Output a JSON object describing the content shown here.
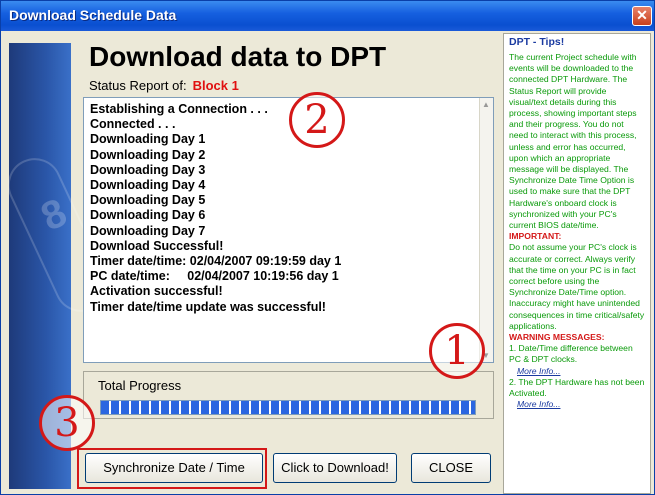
{
  "window": {
    "title": "Download Schedule Data",
    "close_glyph": "✕"
  },
  "header": {
    "heading": "Download data to DPT",
    "status_label": "Status Report of:",
    "status_value": "Block 1"
  },
  "log": {
    "lines": [
      "Establishing a Connection . . .",
      "Connected . . .",
      "Downloading Day 1",
      "Downloading Day 2",
      "Downloading Day 3",
      "Downloading Day 4",
      "Downloading Day 5",
      "Downloading Day 6",
      "Downloading Day 7",
      "Download Successful!",
      "Timer date/time: 02/04/2007 09:19:59 day 1",
      "PC date/time:     02/04/2007 10:19:56 day 1",
      "Activation successful!",
      "Timer date/time update was successful!"
    ]
  },
  "progress": {
    "label": "Total Progress",
    "value_percent": 100
  },
  "buttons": {
    "sync": "Synchronize Date / Time",
    "download": "Click to Download!",
    "close": "CLOSE"
  },
  "annotations": {
    "marker_1": "1",
    "marker_2": "2",
    "marker_3": "3"
  },
  "tips": {
    "title": "DPT - Tips!",
    "para1": "The current Project schedule with events will be downloaded to the connected DPT Hardware. The Status Report will provide visual/text details during this process, showing important steps and their progress. You do not need to interact with this process, unless and error has occurred, upon which an appropriate message will be displayed. The Synchronize Date Time Option is used to make sure that the DPT Hardware's onboard clock is synchronized with your PC's current BIOS date/time.",
    "important_label": "IMPORTANT:",
    "para2": "Do not assume your PC's clock is accurate or correct. Always verify that the time on your PC is in fact correct before using the Synchronize Date/Time option. Inaccuracy might have unintended consequences in time critical/safety applications.",
    "warning_label": "WARNING MESSAGES:",
    "warn1": "1. Date/Time difference between PC & DPT clocks.",
    "more_info_1": "More Info...",
    "warn2": "2. The DPT Hardware has not been Activated.",
    "more_info_2": "More Info..."
  },
  "colors": {
    "accent_red": "#d41818",
    "tips_green": "#0a9a0a",
    "tips_blue": "#1a3aa0",
    "title_blue": "#0a4fd0"
  }
}
